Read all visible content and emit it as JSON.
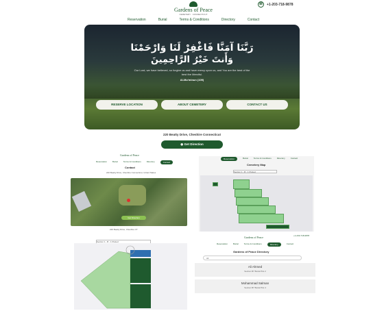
{
  "header": {
    "logo_name": "Gardens of Peace",
    "logo_sub": "CEMETERY · CONNECTICUT",
    "phone": "+1-203-718-9878",
    "nav": [
      "Reservation",
      "Burial",
      "Terms & Conditions",
      "Directory",
      "Contact"
    ]
  },
  "hero": {
    "arabic_line1": "رَبَّنَا آمَنَّا فَاغْفِرْ لَنَا وَارْحَمْنَا",
    "arabic_line2": "وَأَنتَ خَيْرُ الرَّاحِمِينَ",
    "verse": "Our Lord, we have believed, so forgive us and have mercy upon us, and You are the best of the best the Merciful.",
    "citation": "Al-Mu'minun (109)",
    "buttons": [
      "RESERVE LOCATION",
      "ABOUT CEMETERY",
      "CONTACT US"
    ]
  },
  "address": "220 Beatty Drive, Cheshire Connecticut",
  "get_direction": "Get Direction",
  "contact_panel": {
    "logo_name": "Gardens of Peace",
    "nav": [
      "Reservation",
      "Burial",
      "Terms & Conditions",
      "Directory",
      "Contact"
    ],
    "heading": "Contact",
    "address_line": "220 Beatty Drive, Cheshire Connecticut, United States",
    "map_button": "Get Direction",
    "caption": "220 Beatty Drive, Cheshire CT"
  },
  "map_panel": {
    "nav": [
      "Reservation",
      "Burial",
      "Terms & Conditions",
      "Directory",
      "Contact"
    ],
    "heading": "Cemetery Map",
    "section_select": "Section 1 - B - 1 Plotted"
  },
  "bottom_left": {
    "section_select": "Section 1 - B - 1 Plotted"
  },
  "directory": {
    "logo_name": "Gardens of Peace",
    "phone": "+1-203-718-9878",
    "nav": [
      "Reservation",
      "Burial",
      "Terms & Conditions",
      "Directory",
      "Contact"
    ],
    "heading": "Gardens of Peace Directory",
    "search_value": "Ali",
    "entries": [
      {
        "name": "Ali Ahmed",
        "detail": "Section B7 Burial Plot 2"
      },
      {
        "name": "Mohammad Salman",
        "detail": "Section B7 Burial Plot 4"
      }
    ]
  },
  "colors": {
    "brand_green": "#1f5a2e",
    "button_bg": "#f2f2ec",
    "plot_green": "#8fd18f"
  }
}
